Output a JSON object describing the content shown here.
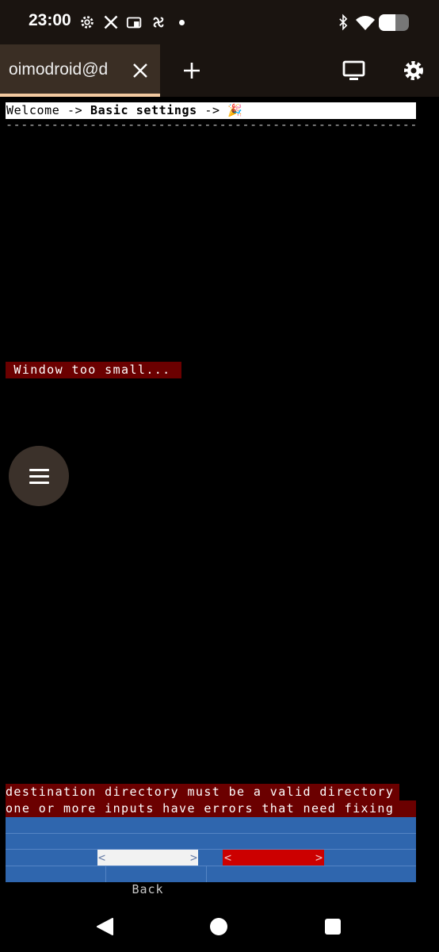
{
  "status_bar": {
    "time": "23:00",
    "icons": [
      "settings-gear-icon",
      "x-logo-icon",
      "cast-device-icon",
      "pinwheel-icon",
      "notification-dot",
      "bluetooth-icon",
      "wifi-icon",
      "battery-icon"
    ],
    "battery_level": 0.55
  },
  "tabs": [
    {
      "title": "oimodroid@d",
      "active": true
    }
  ],
  "toolbar": {
    "icons": [
      "close-tab-icon",
      "new-tab-plus-icon",
      "monitor-icon",
      "settings-gear-icon"
    ]
  },
  "terminal": {
    "breadcrumb": {
      "step1": "Welcome",
      "sep": " -> ",
      "step2": "Basic settings",
      "step3": "🎉"
    },
    "divider": "-------------------------------------------------------------------------",
    "size_warning": " Window too small...",
    "errors": [
      "destination directory must be a valid directory",
      "one or more inputs have errors that need fixing"
    ],
    "buttons": {
      "back_label": "Back",
      "left_arrow": "<",
      "right_arrow": ">"
    }
  },
  "floating_menu": {
    "icon": "hamburger-menu-icon"
  },
  "navigation_bar": {
    "icons": [
      "back-triangle-icon",
      "home-circle-icon",
      "recents-square-icon"
    ]
  },
  "colors": {
    "app_background": "#1a1410",
    "tab_active": "#3a2e24",
    "tab_underline": "#f2c9a0",
    "error_background": "#6b0000",
    "panel_blue": "#2f66ae",
    "next_button_red": "#cc0000"
  }
}
